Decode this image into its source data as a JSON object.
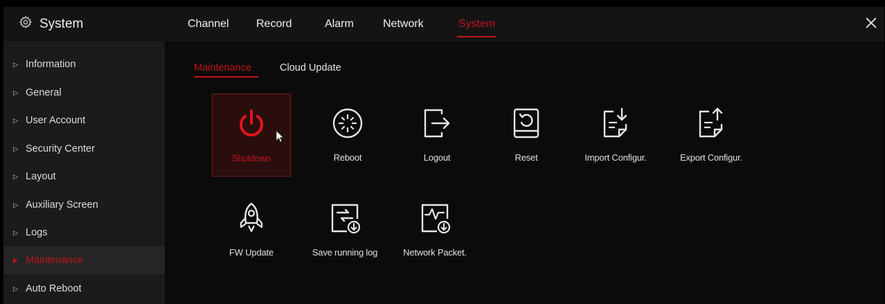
{
  "header": {
    "title": "System",
    "tabs": [
      {
        "label": "Channel"
      },
      {
        "label": "Record"
      },
      {
        "label": "Alarm"
      },
      {
        "label": "Network"
      },
      {
        "label": "System"
      }
    ]
  },
  "sidebar": {
    "items": [
      {
        "label": "Information"
      },
      {
        "label": "General"
      },
      {
        "label": "User Account"
      },
      {
        "label": "Security Center"
      },
      {
        "label": "Layout"
      },
      {
        "label": "Auxiliary Screen"
      },
      {
        "label": "Logs"
      },
      {
        "label": "Maintenance"
      },
      {
        "label": "Auto Reboot"
      }
    ]
  },
  "main": {
    "subtabs": [
      {
        "label": "Maintenance"
      },
      {
        "label": "Cloud Update"
      }
    ],
    "tiles": [
      {
        "label": "Shutdown",
        "icon": "power-icon"
      },
      {
        "label": "Reboot",
        "icon": "reboot-icon"
      },
      {
        "label": "Logout",
        "icon": "logout-icon"
      },
      {
        "label": "Reset",
        "icon": "reset-icon"
      },
      {
        "label": "Import Configur.",
        "icon": "import-config-icon"
      },
      {
        "label": "Export Configur.",
        "icon": "export-config-icon"
      },
      {
        "label": "FW Update",
        "icon": "rocket-icon"
      },
      {
        "label": "Save running log",
        "icon": "save-log-icon"
      },
      {
        "label": "Network Packet.",
        "icon": "network-packet-icon"
      }
    ]
  },
  "colors": {
    "accent": "#c0141a",
    "background": "#0b0b0b",
    "sidebar": "#1b1b1b"
  }
}
